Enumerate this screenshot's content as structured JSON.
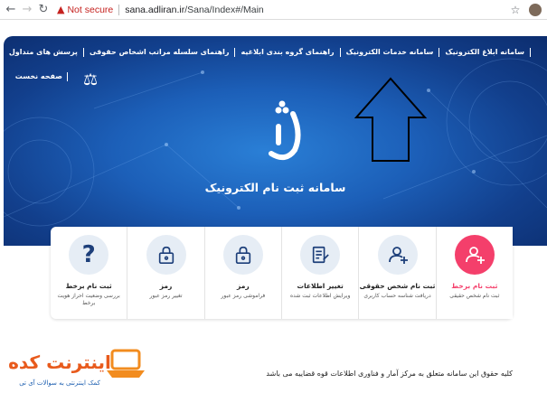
{
  "browser": {
    "security_label": "Not secure",
    "url_host": "sana.adliran.ir",
    "url_path": "/Sana/Index#/Main"
  },
  "nav": {
    "items": [
      "سامانه ابلاغ الکترونیک",
      "سامانه خدمات الکترونیک",
      "راهنمای گروه بندی ابلاغیه",
      "راهنمای سلسله مراتب اشخاص حقوقی",
      "پرسش های متداول"
    ],
    "home": "صفحه نخست"
  },
  "hero": {
    "logo_text": "ثنا",
    "title": "سامانه ثبت نام الکترونیک"
  },
  "cards": [
    {
      "title": "ثبت نام برخط",
      "sub": "ثبت نام شخص حقیقی",
      "icon": "add-user-icon",
      "active": true
    },
    {
      "title": "ثبت نام شخص حقوقی",
      "sub": "دریافت شناسه حساب کاربری",
      "icon": "add-user-icon",
      "active": false
    },
    {
      "title": "تغییر اطلاعات",
      "sub": "ویرایش اطلاعات ثبت شده",
      "icon": "edit-document-icon",
      "active": false
    },
    {
      "title": "رمز",
      "sub": "فراموشی رمز عبور",
      "icon": "lock-icon",
      "active": false
    },
    {
      "title": "رمز",
      "sub": "تغییر رمز عبور",
      "icon": "lock-icon",
      "active": false
    },
    {
      "title": "ثبت نام برخط",
      "sub": "بررسی وضعیت احراز هویت برخط",
      "icon": "question-icon",
      "active": false
    }
  ],
  "footer": {
    "text": "کلیه حقوق این سامانه متعلق به مرکز آمار و فناوری اطلاعات قوه قضاییه می باشد"
  },
  "watermark": {
    "name": "اینترنت کده",
    "tagline": "کمک اینترنتی به سوالات آی تی"
  },
  "colors": {
    "accent": "#f43f6b",
    "hero_blue": "#1c5fb8",
    "icon_blue": "#1d3f7a"
  }
}
